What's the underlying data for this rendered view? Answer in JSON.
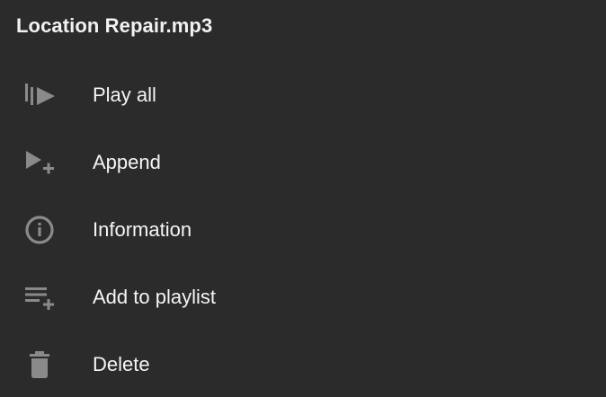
{
  "sheet": {
    "title": "Location Repair.mp3",
    "items": [
      {
        "label": "Play all",
        "icon": "play-all-icon"
      },
      {
        "label": "Append",
        "icon": "append-icon"
      },
      {
        "label": "Information",
        "icon": "information-icon"
      },
      {
        "label": "Add to playlist",
        "icon": "add-to-playlist-icon"
      },
      {
        "label": "Delete",
        "icon": "delete-icon"
      }
    ]
  },
  "colors": {
    "background": "#2b2b2b",
    "text": "#f5f5f5",
    "icon": "#8a8a8a"
  }
}
